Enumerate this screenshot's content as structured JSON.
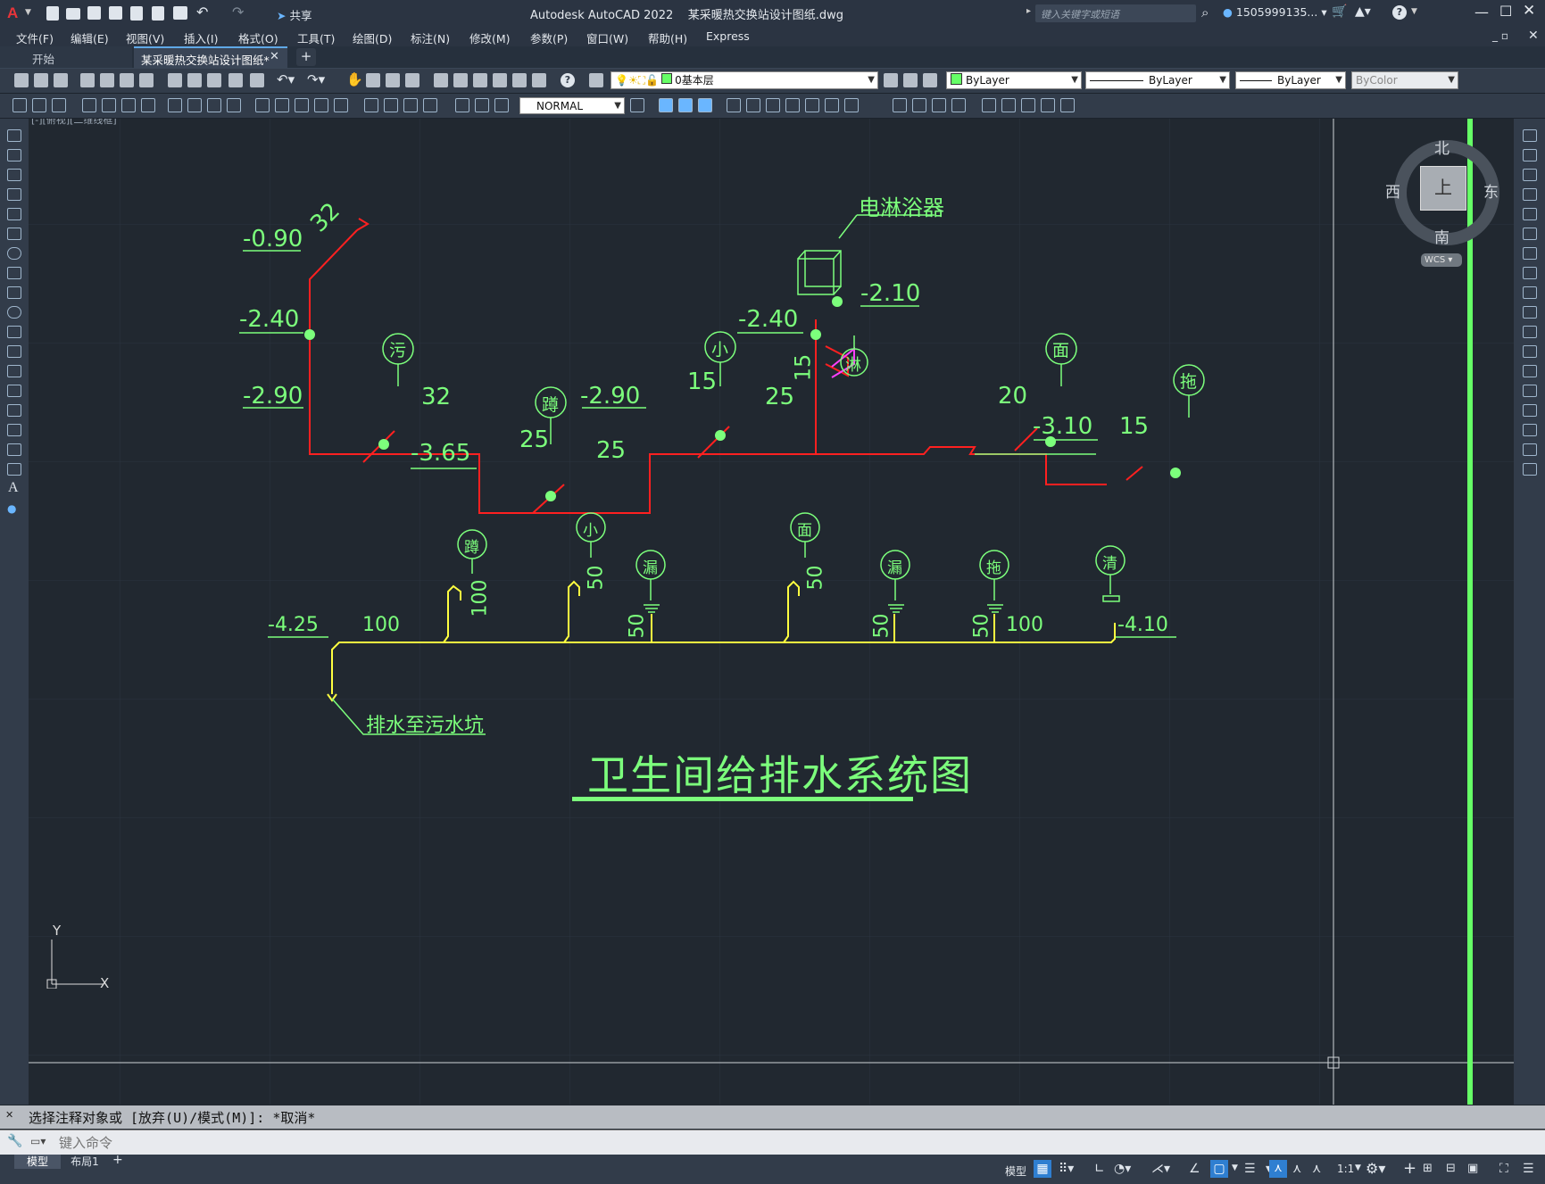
{
  "title_bar": {
    "app_title": "Autodesk AutoCAD 2022",
    "file_name": "某采暖热交换站设计图纸.dwg",
    "share_label": "共享",
    "search_placeholder": "键入关键字或短语",
    "user_name": "1505999135..."
  },
  "menu": {
    "items": [
      "文件(F)",
      "编辑(E)",
      "视图(V)",
      "插入(I)",
      "格式(O)",
      "工具(T)",
      "绘图(D)",
      "标注(N)",
      "修改(M)",
      "参数(P)",
      "窗口(W)",
      "帮助(H)",
      "Express"
    ]
  },
  "tabs": {
    "start": "开始",
    "active": "某采暖热交换站设计图纸*",
    "add": "+"
  },
  "toolbar": {
    "layer": "0基本层",
    "color": "ByLayer",
    "linetype": "ByLayer",
    "lineweight": "ByLayer",
    "plotstyle": "ByColor",
    "textstyle": "NORMAL"
  },
  "viewport": {
    "label": "[-][俯视][二维线框]",
    "compass_north": "北",
    "compass_south": "南",
    "compass_east": "东",
    "compass_west": "西",
    "compass_center": "上",
    "wcs": "WCS",
    "ucs_x": "X",
    "ucs_y": "Y"
  },
  "drawing": {
    "supply_labels": {
      "top_elev": "-0.90",
      "top_size": "32",
      "left_elev": "-2.40",
      "left_low": "-2.90",
      "wu": "污",
      "seg32": "32",
      "dun": "蹲",
      "pit_elev": "-3.65",
      "d25a": "25",
      "d25b": "25",
      "mid_elev": "-2.90",
      "xiao": "小",
      "d15": "15",
      "d25c": "25",
      "riser_elev": "-2.40",
      "riser_size": "15",
      "heater": "电淋浴器",
      "heater_elev": "-2.10",
      "lin": "淋",
      "mian": "面",
      "d20": "20",
      "right_elev": "-3.10",
      "d15b": "15",
      "tuo": "拖"
    },
    "drain_labels": {
      "left_elev": "-4.25",
      "main_size": "100",
      "dun": "蹲",
      "dun_size": "100",
      "xiao": "小",
      "xiao_size": "50",
      "lou1": "漏",
      "lou1_size": "50",
      "mian": "面",
      "mian_size": "50",
      "lou2": "漏",
      "lou2_size": "50",
      "tuo": "拖",
      "tuo_size": "50",
      "size100b": "100",
      "qing": "清",
      "right_elev": "-4.10",
      "outlet": "排水至污水坑"
    },
    "title": "卫生间给排水系统图"
  },
  "command": {
    "history": "选择注释对象或 [放弃(U)/模式(M)]: *取消*",
    "placeholder": "键入命令"
  },
  "status": {
    "model_tab": "模型",
    "layout_tab": "布局1",
    "add_tab": "+",
    "model_label": "模型",
    "scale": "1:1"
  },
  "colors": {
    "supply_pipe": "#ff2020",
    "drain_pipe": "#ffff40",
    "annotation": "#7cff7c",
    "background": "#212830"
  }
}
